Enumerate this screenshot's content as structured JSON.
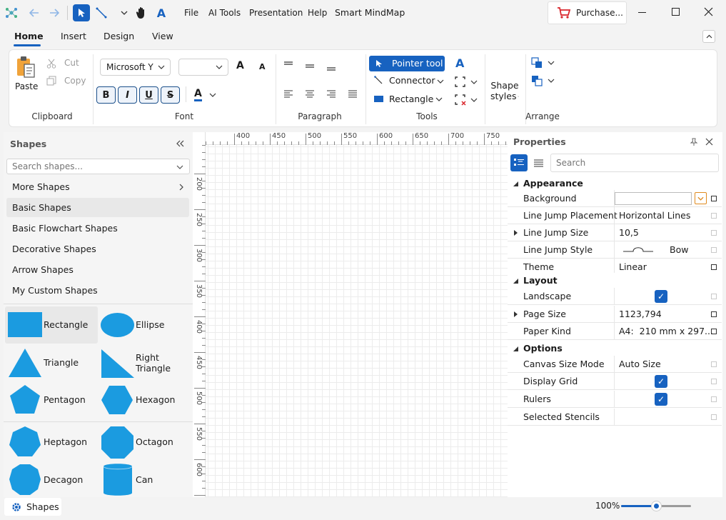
{
  "titlebar": {
    "menus": [
      "File",
      "AI Tools",
      "Presentation",
      "Help"
    ],
    "app_title": "Smart MindMap",
    "purchase_label": "Purchase...",
    "font_a_glyph": "A"
  },
  "ribbon_tabs": [
    "Home",
    "Insert",
    "Design",
    "View"
  ],
  "ribbon": {
    "clipboard": {
      "paste": "Paste",
      "cut": "Cut",
      "copy": "Copy",
      "label": "Clipboard"
    },
    "font": {
      "family": "Microsoft Y",
      "size": "",
      "bold": "B",
      "italic": "I",
      "underline": "U",
      "strike": "S",
      "color_glyph": "A",
      "grow_glyph": "A",
      "shrink_glyph": "A",
      "label": "Font"
    },
    "paragraph": {
      "label": "Paragraph"
    },
    "tools": {
      "pointer": "Pointer tool",
      "connector": "Connector",
      "rectangle": "Rectangle",
      "text_glyph": "A",
      "label": "Tools"
    },
    "shape_styles": {
      "line1": "Shape",
      "line2": "styles"
    },
    "arrange": {
      "label": "Arrange"
    }
  },
  "shapes_panel": {
    "title": "Shapes",
    "search_placeholder": "Search shapes...",
    "categories": [
      "More Shapes",
      "Basic Shapes",
      "Basic Flowchart Shapes",
      "Decorative Shapes",
      "Arrow Shapes",
      "My Custom Shapes"
    ],
    "shapes": [
      "Rectangle",
      "Ellipse",
      "Triangle",
      "Right Triangle",
      "Pentagon",
      "Hexagon",
      "Heptagon",
      "Octagon",
      "Decagon",
      "Can"
    ],
    "shape_color": "#1b9be0"
  },
  "rulers": {
    "top": [
      "400",
      "450",
      "500",
      "550",
      "600",
      "650",
      "700",
      "750"
    ],
    "left": [
      "200",
      "250",
      "300",
      "350",
      "400",
      "450",
      "500",
      "550",
      "600"
    ]
  },
  "properties": {
    "title": "Properties",
    "search_placeholder": "Search",
    "categories": [
      "Appearance",
      "Layout",
      "Options"
    ],
    "rows": {
      "background": {
        "name": "Background",
        "value": ""
      },
      "line_jump_placement": {
        "name": "Line Jump Placement",
        "value": "Horizontal Lines"
      },
      "line_jump_size": {
        "name": "Line Jump Size",
        "value": "10,5"
      },
      "line_jump_style": {
        "name": "Line Jump Style",
        "value": "Bow"
      },
      "theme": {
        "name": "Theme",
        "value": "Linear"
      },
      "landscape": {
        "name": "Landscape",
        "value": true
      },
      "page_size": {
        "name": "Page Size",
        "value": "1123,794"
      },
      "paper_kind": {
        "name": "Paper Kind",
        "value": "A4:  210 mm x 297..."
      },
      "canvas_size_mode": {
        "name": "Canvas Size Mode",
        "value": "Auto Size"
      },
      "display_grid": {
        "name": "Display Grid",
        "value": true
      },
      "rulers": {
        "name": "Rulers",
        "value": true
      },
      "selected_stencils": {
        "name": "Selected Stencils",
        "value": ""
      }
    }
  },
  "statusbar": {
    "shapes_tab": "Shapes",
    "zoom": "100%",
    "zoom_fraction": 0.5
  },
  "colors": {
    "accent": "#1762c0",
    "shape": "#1b9be0"
  }
}
